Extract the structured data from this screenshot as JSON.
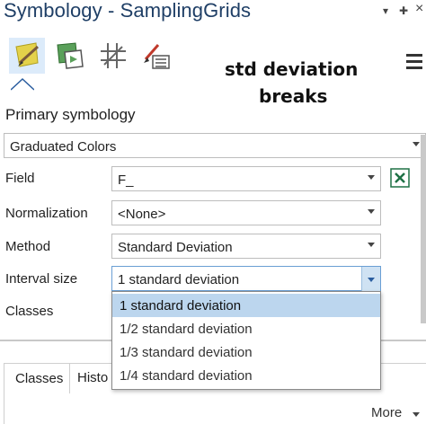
{
  "title_bar": {
    "title": "Symbology - SamplingGrids",
    "pin_glyph": "▾",
    "pin2_glyph": "✚",
    "close_glyph": "×"
  },
  "toolbar": {
    "tools": [
      {
        "name": "primary-symbology-icon",
        "active": true
      },
      {
        "name": "vary-symbology-icon",
        "active": false
      },
      {
        "name": "label-classes-icon",
        "active": false
      },
      {
        "name": "symbol-layer-drawing-icon",
        "active": false
      }
    ]
  },
  "annotation": {
    "line1": "std deviation",
    "line2": "breaks"
  },
  "panel": {
    "section_title": "Primary symbology",
    "renderer": "Graduated Colors",
    "field": {
      "label": "Field",
      "value": "F_"
    },
    "normalization": {
      "label": "Normalization",
      "value": "<None>"
    },
    "method": {
      "label": "Method",
      "value": "Standard Deviation"
    },
    "interval_size": {
      "label": "Interval size",
      "value": "1 standard deviation"
    },
    "classes": {
      "label": "Classes"
    }
  },
  "dropdown": {
    "options": [
      "1 standard deviation",
      "1/2 standard deviation",
      "1/3 standard deviation",
      "1/4 standard deviation"
    ],
    "selected_index": 0
  },
  "tabs": {
    "classes": "Classes",
    "histogram": "Histo"
  },
  "footer": {
    "more": "More"
  },
  "colors": {
    "title": "#1f3f66",
    "selection": "#bcd6ee",
    "accent": "#2a5d9f",
    "excel_green": "#1e7145"
  }
}
